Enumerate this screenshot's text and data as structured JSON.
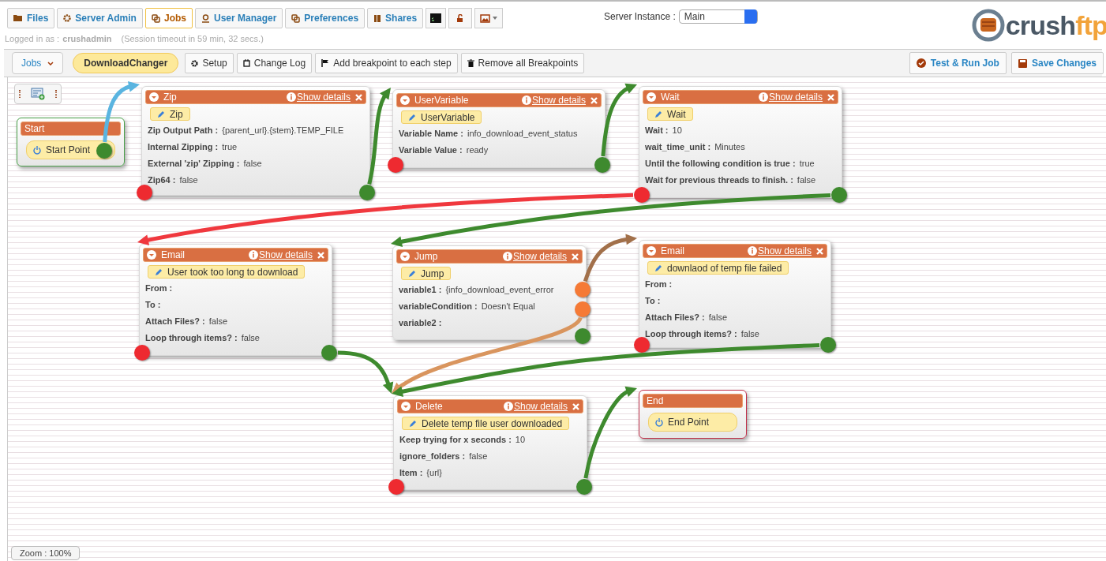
{
  "nav_tabs": [
    {
      "label": "Files",
      "selected": false
    },
    {
      "label": "Server Admin",
      "selected": false
    },
    {
      "label": "Jobs",
      "selected": true
    },
    {
      "label": "User Manager",
      "selected": false
    },
    {
      "label": "Preferences",
      "selected": false
    },
    {
      "label": "Shares",
      "selected": false
    }
  ],
  "session": {
    "prefix": "Logged in as :",
    "user": "crushadmin",
    "timeout": "(Session timeout in 59 min, 32 secs.)"
  },
  "server_instance": {
    "label": "Server Instance :",
    "value": "Main"
  },
  "logo": {
    "text_dark": "crush",
    "text_accent": "ftp"
  },
  "toolbar": {
    "jobs_menu": "Jobs",
    "job_name": "DownloadChanger",
    "buttons": [
      "Setup",
      "Change Log",
      "Add breakpoint to each step",
      "Remove all Breakpoints"
    ],
    "right_buttons": [
      "Test & Run Job",
      "Save Changes"
    ]
  },
  "nodes": [
    {
      "kind": "start",
      "title": "Start",
      "badge": "Start Point"
    },
    {
      "kind": "step",
      "title": "Zip",
      "details": "Show details",
      "badge": "Zip",
      "fields": [
        {
          "label": "Zip Output Path :",
          "value": "{parent_url}.{stem}.TEMP_FILE"
        },
        {
          "label": "Internal Zipping :",
          "value": "true"
        },
        {
          "label": "External 'zip' Zipping :",
          "value": "false"
        },
        {
          "label": "Zip64 :",
          "value": "false"
        }
      ]
    },
    {
      "kind": "step",
      "title": "UserVariable",
      "details": "Show details",
      "badge": "UserVariable",
      "fields": [
        {
          "label": "Variable Name :",
          "value": "info_download_event_status"
        },
        {
          "label": "Variable Value :",
          "value": "ready"
        }
      ]
    },
    {
      "kind": "step",
      "title": "Wait",
      "details": "Show details",
      "badge": "Wait",
      "fields": [
        {
          "label": "Wait :",
          "value": "10"
        },
        {
          "label": "wait_time_unit :",
          "value": "Minutes"
        },
        {
          "label": "Until the following condition is true :",
          "value": "true"
        },
        {
          "label": "Wait for previous threads to finish. :",
          "value": "false"
        }
      ]
    },
    {
      "kind": "step",
      "title": "Email",
      "details": "Show details",
      "badge": "User took too long to download",
      "fields": [
        {
          "label": "From :"
        },
        {
          "label": "To :"
        },
        {
          "label": "Attach Files? :",
          "value": "false"
        },
        {
          "label": "Loop through items? :",
          "value": "false"
        }
      ]
    },
    {
      "kind": "jump",
      "title": "Jump",
      "details": "Show details",
      "badge": "Jump",
      "fields": [
        {
          "label": "variable1 :",
          "value": "{info_download_event_error"
        },
        {
          "label": "variableCondition :",
          "value": "Doesn't Equal"
        },
        {
          "label": "variable2 :"
        }
      ]
    },
    {
      "kind": "step",
      "title": "Email",
      "details": "Show details",
      "badge": "downlaod of temp file failed",
      "fields": [
        {
          "label": "From :"
        },
        {
          "label": "To :"
        },
        {
          "label": "Attach Files? :",
          "value": "false"
        },
        {
          "label": "Loop through items? :",
          "value": "false"
        }
      ]
    },
    {
      "kind": "step",
      "title": "Delete",
      "details": "Show details",
      "badge": "Delete temp file user downloaded",
      "fields": [
        {
          "label": "Keep trying for x seconds :",
          "value": "10"
        },
        {
          "label": "ignore_folders :",
          "value": "false"
        },
        {
          "label": "Item :",
          "value": "{url}"
        }
      ]
    },
    {
      "kind": "end",
      "title": "End",
      "badge": "End Point"
    }
  ],
  "connections": [
    {
      "color": "#5ab4e0"
    },
    {
      "color": "#3e8a2e"
    },
    {
      "color": "#3e8a2e"
    },
    {
      "color": "#f0383e"
    },
    {
      "color": "#3e8a2e"
    },
    {
      "color": "#a2704a"
    },
    {
      "color": "#d9955e"
    },
    {
      "color": "#3e8a2e"
    },
    {
      "color": "#3e8a2e"
    },
    {
      "color": "#3e8a2e"
    }
  ],
  "zoom_label": "Zoom : 100%"
}
